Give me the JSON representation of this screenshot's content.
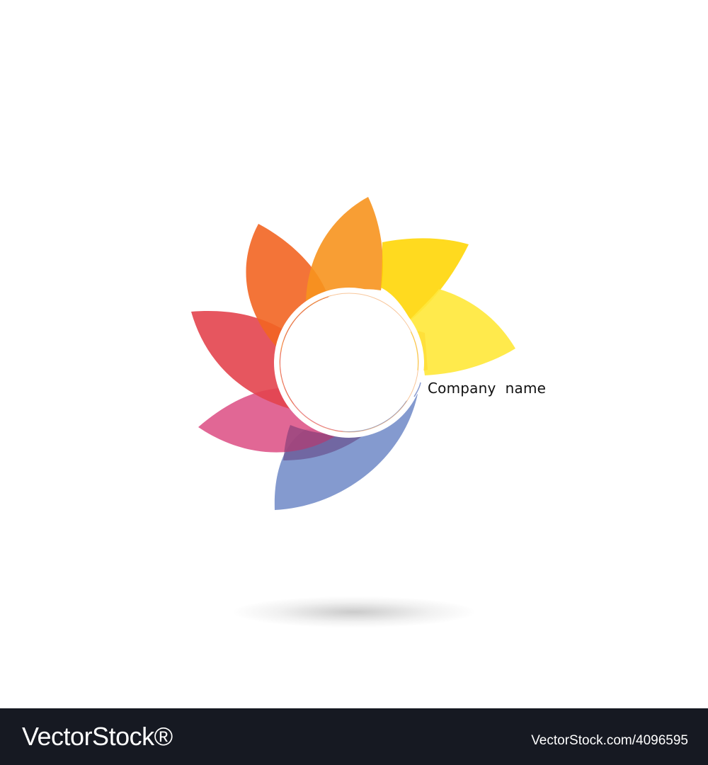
{
  "logo": {
    "company_name": "Company  name",
    "petal_colors": [
      "#7d95cc",
      "#de5a8c",
      "#e3444e",
      "#f26522",
      "#f7941e",
      "#ffd500",
      "#ffe83d"
    ],
    "ring_color": "#ffffff"
  },
  "footer": {
    "brand": "VectorStock®",
    "image_id": "VectorStock.com/4096595"
  }
}
